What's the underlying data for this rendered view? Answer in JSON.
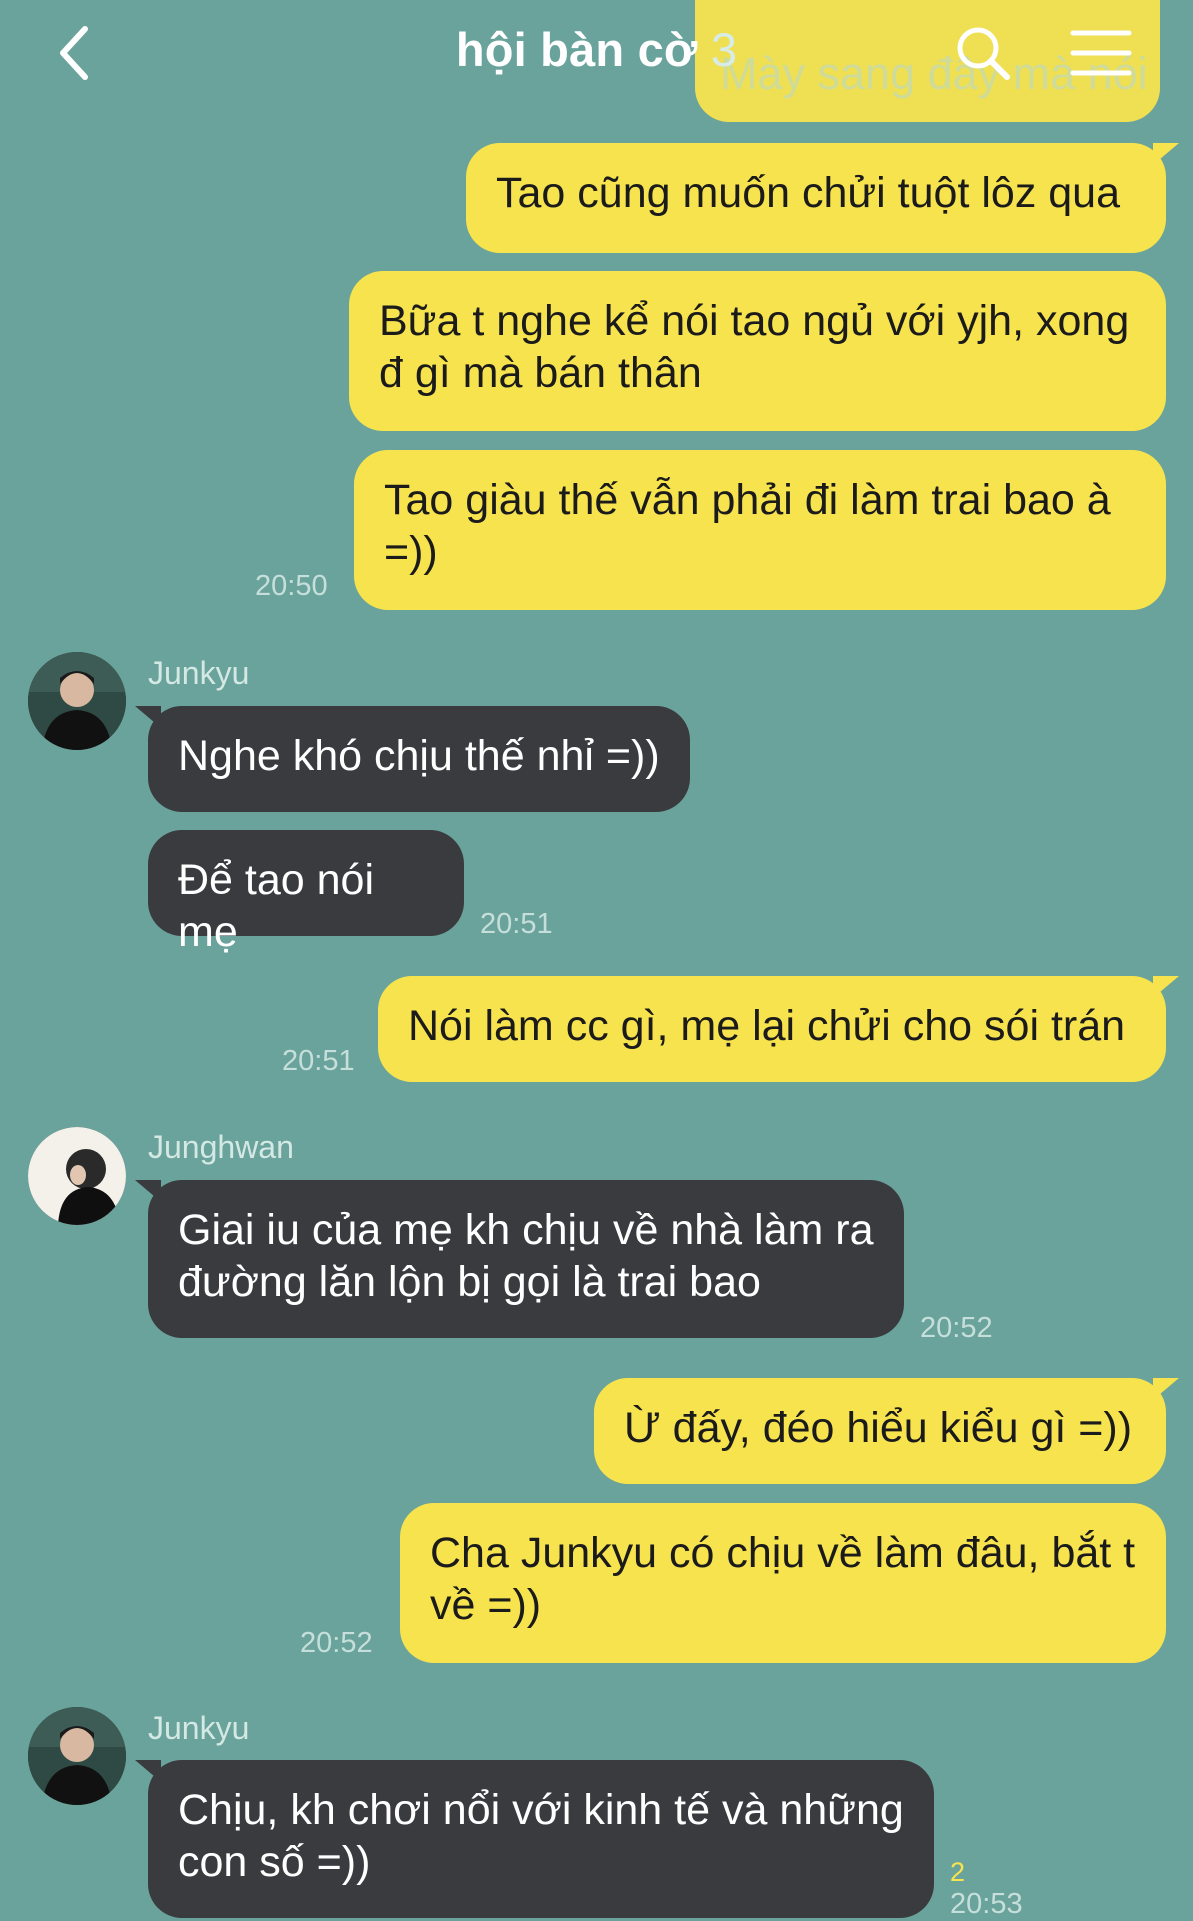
{
  "header": {
    "title": "hội bàn cờ",
    "member_count": "3",
    "ghost_preview": "Mày sang đây mà nói"
  },
  "messages": [
    {
      "id": "m1",
      "text": "Tao cũng muốn chửi tuột lôz qua"
    },
    {
      "id": "m2",
      "text": "Bữa t nghe kể nói tao ngủ với yjh, xong đ gì mà bán thân"
    },
    {
      "id": "m3",
      "text": "Tao giàu thế vẫn phải đi làm trai bao à =))",
      "time": "20:50"
    },
    {
      "id": "m4",
      "sender": "Junkyu",
      "text": "Nghe khó chịu thế nhỉ =))"
    },
    {
      "id": "m5",
      "text": "Để tao nói mẹ",
      "time": "20:51"
    },
    {
      "id": "m6",
      "text": "Nói làm cc gì, mẹ lại chửi cho sói trán",
      "time": "20:51"
    },
    {
      "id": "m7",
      "sender": "Junghwan",
      "text": "Giai iu của mẹ kh chịu về nhà làm ra đường lăn lộn bị gọi là trai bao",
      "time": "20:52"
    },
    {
      "id": "m8",
      "text": "Ừ đấy, đéo hiểu kiểu gì =))"
    },
    {
      "id": "m9",
      "text": "Cha Junkyu có chịu về làm đâu, bắt t về =))",
      "time": "20:52"
    },
    {
      "id": "m10",
      "sender": "Junkyu",
      "text": "Chịu, kh chơi nổi với kinh tế và những con số =))",
      "time": "20:53",
      "unread": "2"
    }
  ],
  "colors": {
    "background": "#6aa39b",
    "outgoing_bubble": "#f7e34e",
    "incoming_bubble": "#3a3b3f",
    "unread": "#f7e34e"
  },
  "icons": [
    "back-icon",
    "search-icon",
    "menu-icon"
  ]
}
